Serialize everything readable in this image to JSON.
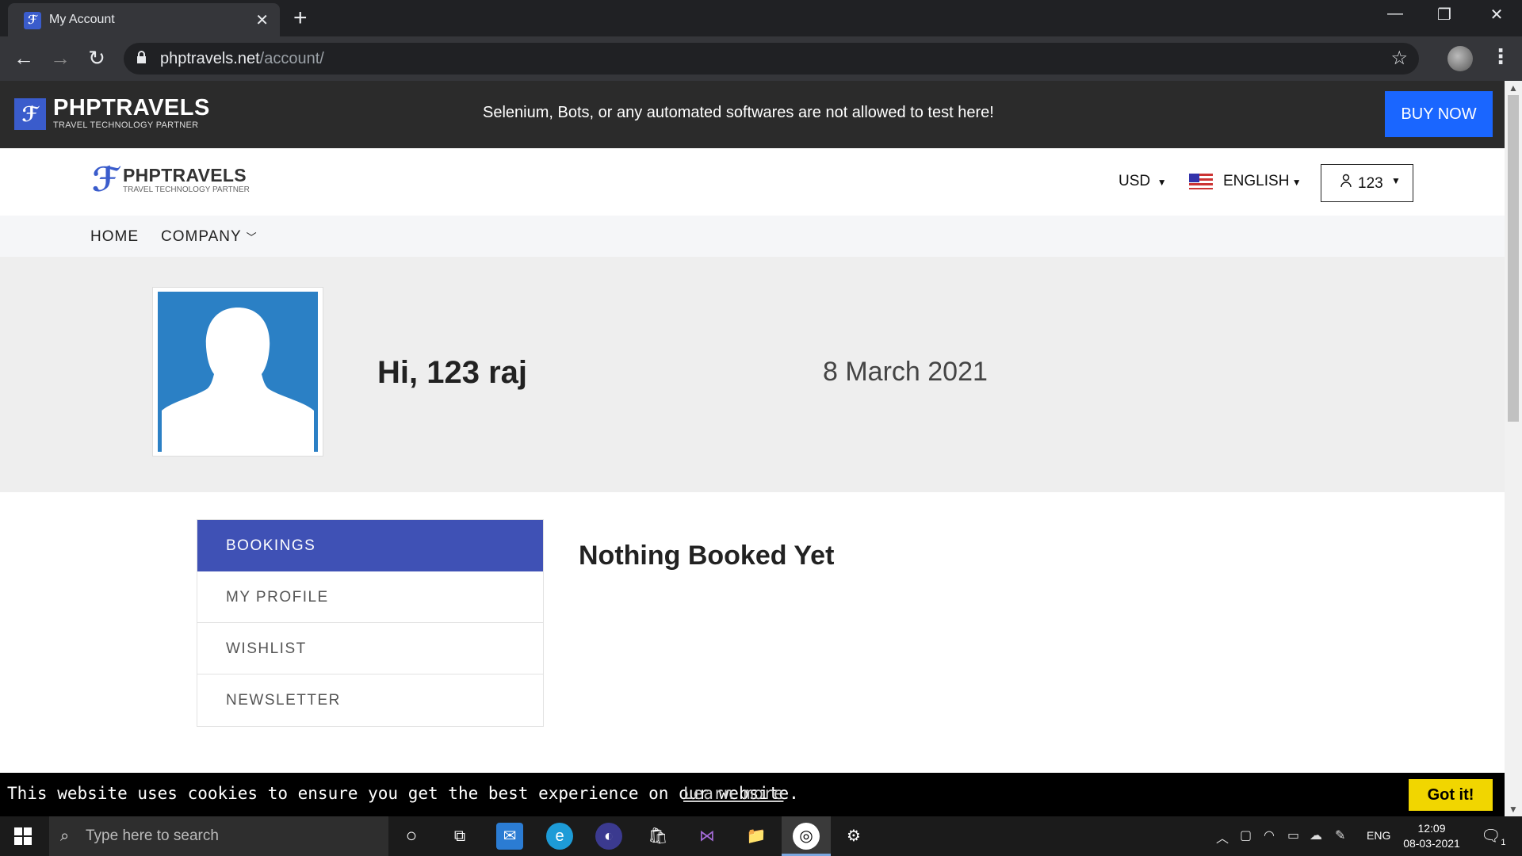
{
  "browser": {
    "tab_title": "My Account",
    "url_host": "phptravels.net",
    "url_path": "/account/"
  },
  "promo": {
    "logo_name": "PHPTRAVELS",
    "logo_tag": "TRAVEL TECHNOLOGY PARTNER",
    "message": "Selenium, Bots, or any automated softwares are not allowed to test here!",
    "buy_now": "BUY NOW"
  },
  "header": {
    "logo_name": "PHPTRAVELS",
    "logo_tag": "TRAVEL TECHNOLOGY PARTNER",
    "currency": "USD",
    "language": "ENGLISH",
    "user": "123"
  },
  "menu": {
    "home": "HOME",
    "company": "COMPANY"
  },
  "hero": {
    "greeting": "Hi, 123 raj",
    "date": "8 March 2021"
  },
  "side_menu": {
    "items": [
      "BOOKINGS",
      "MY PROFILE",
      "WISHLIST",
      "NEWSLETTER"
    ],
    "active": "BOOKINGS"
  },
  "content": {
    "empty_message": "Nothing Booked Yet"
  },
  "cookie": {
    "message": "This website uses cookies to ensure you get the best experience on our website.",
    "learn_more": "Learn more",
    "got_it": "Got it!"
  },
  "taskbar": {
    "search_placeholder": "Type here to search",
    "language": "ENG",
    "time": "12:09",
    "date": "08-03-2021",
    "notifications": "1"
  },
  "colors": {
    "primary": "#3f51b5",
    "buy_now": "#1a66ff",
    "cookie_button": "#f1d600"
  }
}
